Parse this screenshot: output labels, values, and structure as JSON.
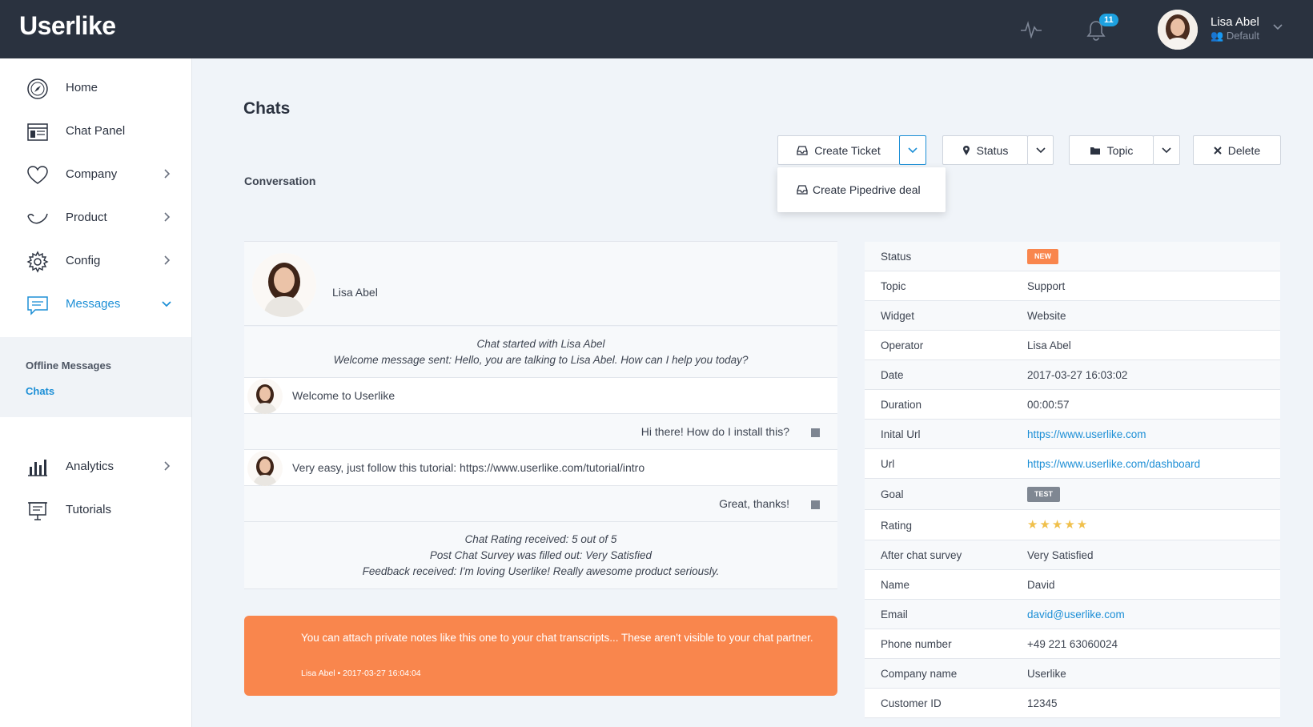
{
  "topbar": {
    "logo": "Userlike",
    "notifications_count": "11",
    "user_name": "Lisa Abel",
    "user_role": "Default"
  },
  "sidebar": {
    "items": [
      {
        "label": "Home",
        "icon": "compass-icon"
      },
      {
        "label": "Chat Panel",
        "icon": "chat-panel-icon"
      },
      {
        "label": "Company",
        "icon": "heart-icon"
      },
      {
        "label": "Product",
        "icon": "product-icon"
      },
      {
        "label": "Config",
        "icon": "gear-icon"
      },
      {
        "label": "Messages",
        "icon": "message-icon"
      },
      {
        "label": "Analytics",
        "icon": "bar-chart-icon"
      },
      {
        "label": "Tutorials",
        "icon": "presentation-icon"
      }
    ],
    "subnav": {
      "offline": "Offline Messages",
      "chats": "Chats"
    }
  },
  "page": {
    "title": "Chats",
    "section": "Conversation"
  },
  "toolbar": {
    "create_ticket": "Create Ticket",
    "status": "Status",
    "topic": "Topic",
    "delete": "Delete",
    "dropdown_item": "Create Pipedrive deal"
  },
  "conversation": {
    "participant": "Lisa Abel",
    "system1": [
      "Chat started with Lisa Abel",
      "Welcome message sent: Hello, you are talking to Lisa Abel. How can I help you today?"
    ],
    "messages": [
      {
        "from": "operator",
        "text": "Welcome to Userlike"
      },
      {
        "from": "visitor",
        "text": "Hi there! How do I install this?"
      },
      {
        "from": "operator",
        "text": "Very easy, just follow this tutorial: https://www.userlike.com/tutorial/intro"
      },
      {
        "from": "visitor",
        "text": "Great, thanks!"
      }
    ],
    "system2": [
      "Chat Rating received: 5 out of 5",
      "Post Chat Survey was filled out: Very Satisfied",
      "Feedback received: I'm loving Userlike! Really awesome product seriously."
    ],
    "note": "You can attach private notes like this one to your chat transcripts... These aren't visible to your chat partner.",
    "note_meta": "Lisa Abel • 2017-03-27 16:04:04"
  },
  "details": {
    "rows": [
      {
        "key": "Status",
        "value": "NEW",
        "kind": "tag-new"
      },
      {
        "key": "Topic",
        "value": "Support"
      },
      {
        "key": "Widget",
        "value": "Website"
      },
      {
        "key": "Operator",
        "value": "Lisa Abel"
      },
      {
        "key": "Date",
        "value": "2017-03-27 16:03:02"
      },
      {
        "key": "Duration",
        "value": "00:00:57"
      },
      {
        "key": "Inital Url",
        "value": "https://www.userlike.com",
        "kind": "link"
      },
      {
        "key": "Url",
        "value": "https://www.userlike.com/dashboard",
        "kind": "link"
      },
      {
        "key": "Goal",
        "value": "TEST",
        "kind": "tag-test"
      },
      {
        "key": "Rating",
        "value": "★★★★★",
        "rating": 5
      },
      {
        "key": "After chat survey",
        "value": "Very Satisfied"
      },
      {
        "key": "Name",
        "value": "David"
      },
      {
        "key": "Email",
        "value": "david@userlike.com",
        "kind": "link"
      },
      {
        "key": "Phone number",
        "value": "+49 221 63060024"
      },
      {
        "key": "Company name",
        "value": "Userlike"
      },
      {
        "key": "Customer ID",
        "value": "12345"
      }
    ]
  },
  "colors": {
    "topbar": "#2a323f",
    "accent": "#1d8fd6",
    "note": "#f9864d",
    "tag_new": "#f9864d",
    "tag_test": "#7f8792",
    "star": "#f0c04c"
  }
}
